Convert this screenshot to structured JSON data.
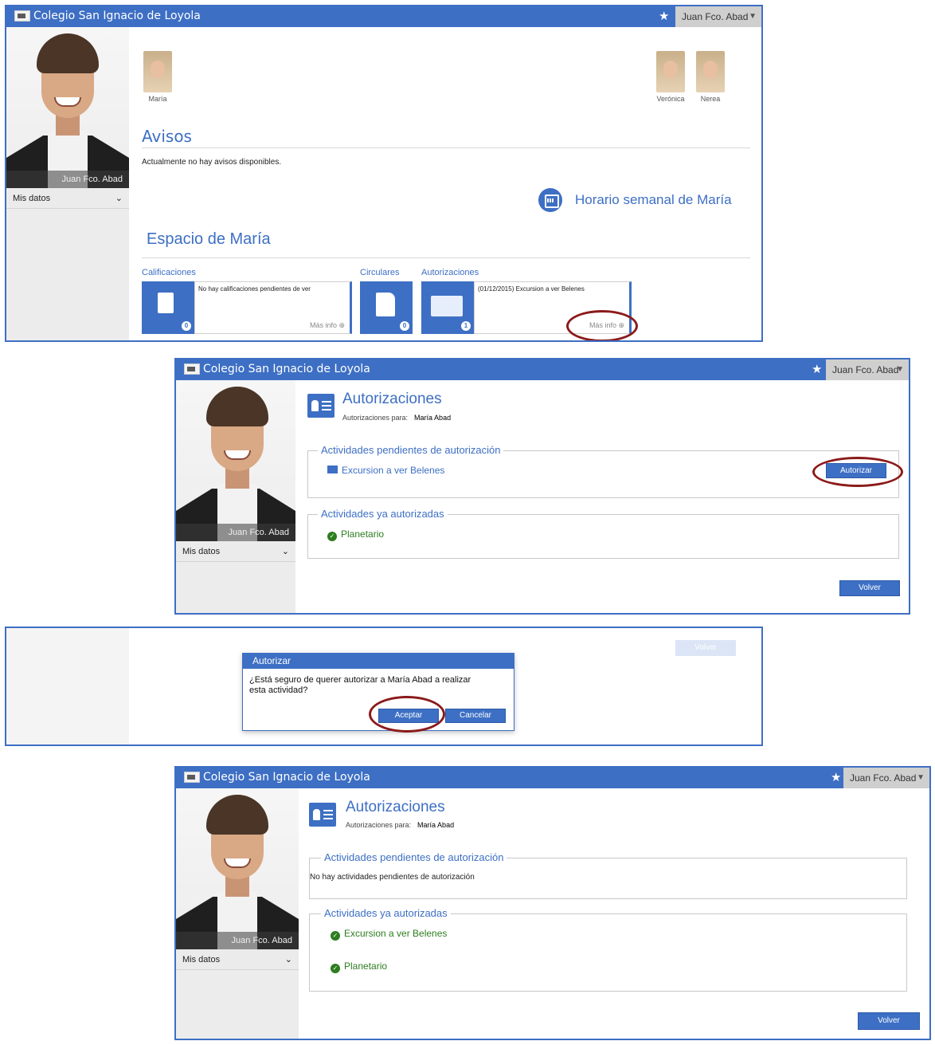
{
  "colors": {
    "accent": "#3d6fc4",
    "success": "#2e7d20",
    "highlight_ring": "#8b1a1a"
  },
  "app": {
    "title": "Colegio San Ignacio de Loyola",
    "user_name": "Juan Fco. Abad",
    "photo_caption": "Juan Fco. Abad",
    "mis_datos": "Mis datos"
  },
  "panel1": {
    "selected_child": "María",
    "other_children": [
      "Verónica",
      "Nerea"
    ],
    "avisos_title": "Avisos",
    "avisos_empty": "Actualmente no hay avisos disponibles.",
    "horario_link": "Horario semanal de María",
    "espacio_title": "Espacio de María",
    "tiles": {
      "calificaciones": {
        "label": "Calificaciones",
        "count": "0",
        "text": "No hay calificaciones pendientes de ver",
        "more": "Más info"
      },
      "circulares": {
        "label": "Circulares",
        "count": "0"
      },
      "autorizaciones": {
        "label": "Autorizaciones",
        "count": "1",
        "text": "(01/12/2015) Excursion a ver Belenes",
        "more": "Más info"
      }
    }
  },
  "panel2": {
    "title": "Autorizaciones",
    "for_label": "Autorizaciones para:",
    "for_name": "María Abad",
    "pending_legend": "Actividades pendientes de autorización",
    "pending_items": [
      "Excursion a ver Belenes"
    ],
    "authorize_button": "Autorizar",
    "done_legend": "Actividades ya autorizadas",
    "done_items": [
      "Planetario"
    ],
    "back_button": "Volver"
  },
  "panel3": {
    "back_button": "Volver",
    "dialog_title": "Autorizar",
    "dialog_text": "¿Está seguro de querer autorizar a María Abad a realizar esta actividad?",
    "accept_button": "Aceptar",
    "cancel_button": "Cancelar"
  },
  "panel4": {
    "title": "Autorizaciones",
    "for_label": "Autorizaciones para:",
    "for_name": "María Abad",
    "pending_legend": "Actividades pendientes de autorización",
    "pending_empty": "No hay actividades pendientes de autorización",
    "done_legend": "Actividades ya autorizadas",
    "done_items": [
      "Excursion a ver Belenes",
      "Planetario"
    ],
    "back_button": "Volver"
  }
}
